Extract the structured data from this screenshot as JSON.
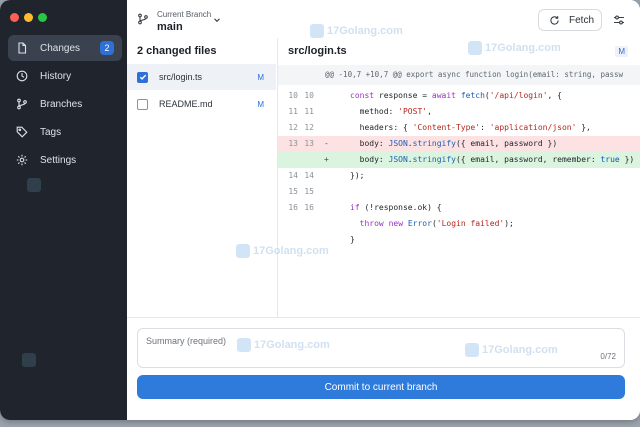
{
  "sidebar": {
    "items": [
      {
        "label": "Changes",
        "icon": "file-icon",
        "badge": "2",
        "active": true
      },
      {
        "label": "History",
        "icon": "clock-icon"
      },
      {
        "label": "Branches",
        "icon": "branch-icon"
      },
      {
        "label": "Tags",
        "icon": "tag-icon"
      },
      {
        "label": "Settings",
        "icon": "gear-icon"
      }
    ]
  },
  "toolbar": {
    "branch_caption": "Current Branch",
    "branch_name": "main",
    "fetch_label": "Fetch"
  },
  "files": {
    "header": "2 changed files",
    "items": [
      {
        "name": "src/login.ts",
        "status": "M",
        "checked": true,
        "selected": true
      },
      {
        "name": "README.md",
        "status": "M",
        "checked": false
      }
    ]
  },
  "diff": {
    "file": "src/login.ts",
    "status": "M",
    "hunk": "@@ -10,7 +10,7 @@  export async function login(email: string, passw",
    "lines": [
      {
        "old": "10",
        "new": "10",
        "mark": "",
        "type": "ctx",
        "text": "const response = await fetch('/api/login', {"
      },
      {
        "old": "11",
        "new": "11",
        "mark": "",
        "type": "ctx",
        "text": "  method: 'POST',"
      },
      {
        "old": "12",
        "new": "12",
        "mark": "",
        "type": "ctx",
        "text": "  headers: { 'Content-Type': 'application/json' },"
      },
      {
        "old": "13",
        "new": "13",
        "mark": "-",
        "type": "del",
        "text": "  body: JSON.stringify({ email, password })"
      },
      {
        "old": "",
        "new": "",
        "mark": "+",
        "type": "add",
        "text": "  body: JSON.stringify({ email, password, remember: true })"
      },
      {
        "old": "14",
        "new": "14",
        "mark": "",
        "type": "ctx",
        "text": "});"
      },
      {
        "old": "15",
        "new": "15",
        "mark": "",
        "type": "ctx",
        "text": ""
      },
      {
        "old": "16",
        "new": "16",
        "mark": "",
        "type": "ctx",
        "text": "if (!response.ok) {"
      },
      {
        "old": "",
        "new": "",
        "mark": "",
        "type": "ctx",
        "text": "  throw new Error('Login failed');"
      },
      {
        "old": "",
        "new": "",
        "mark": "",
        "type": "ctx",
        "text": "}"
      }
    ]
  },
  "commit": {
    "summary_placeholder": "Summary (required)",
    "char_count": "0/72",
    "button_label": "Commit to current branch"
  },
  "watermark": "17Golang.com",
  "colors": {
    "accent": "#2f6fd8",
    "sidebar": "#20252d",
    "deletion": "#fde2e4",
    "addition": "#dbf4df"
  }
}
